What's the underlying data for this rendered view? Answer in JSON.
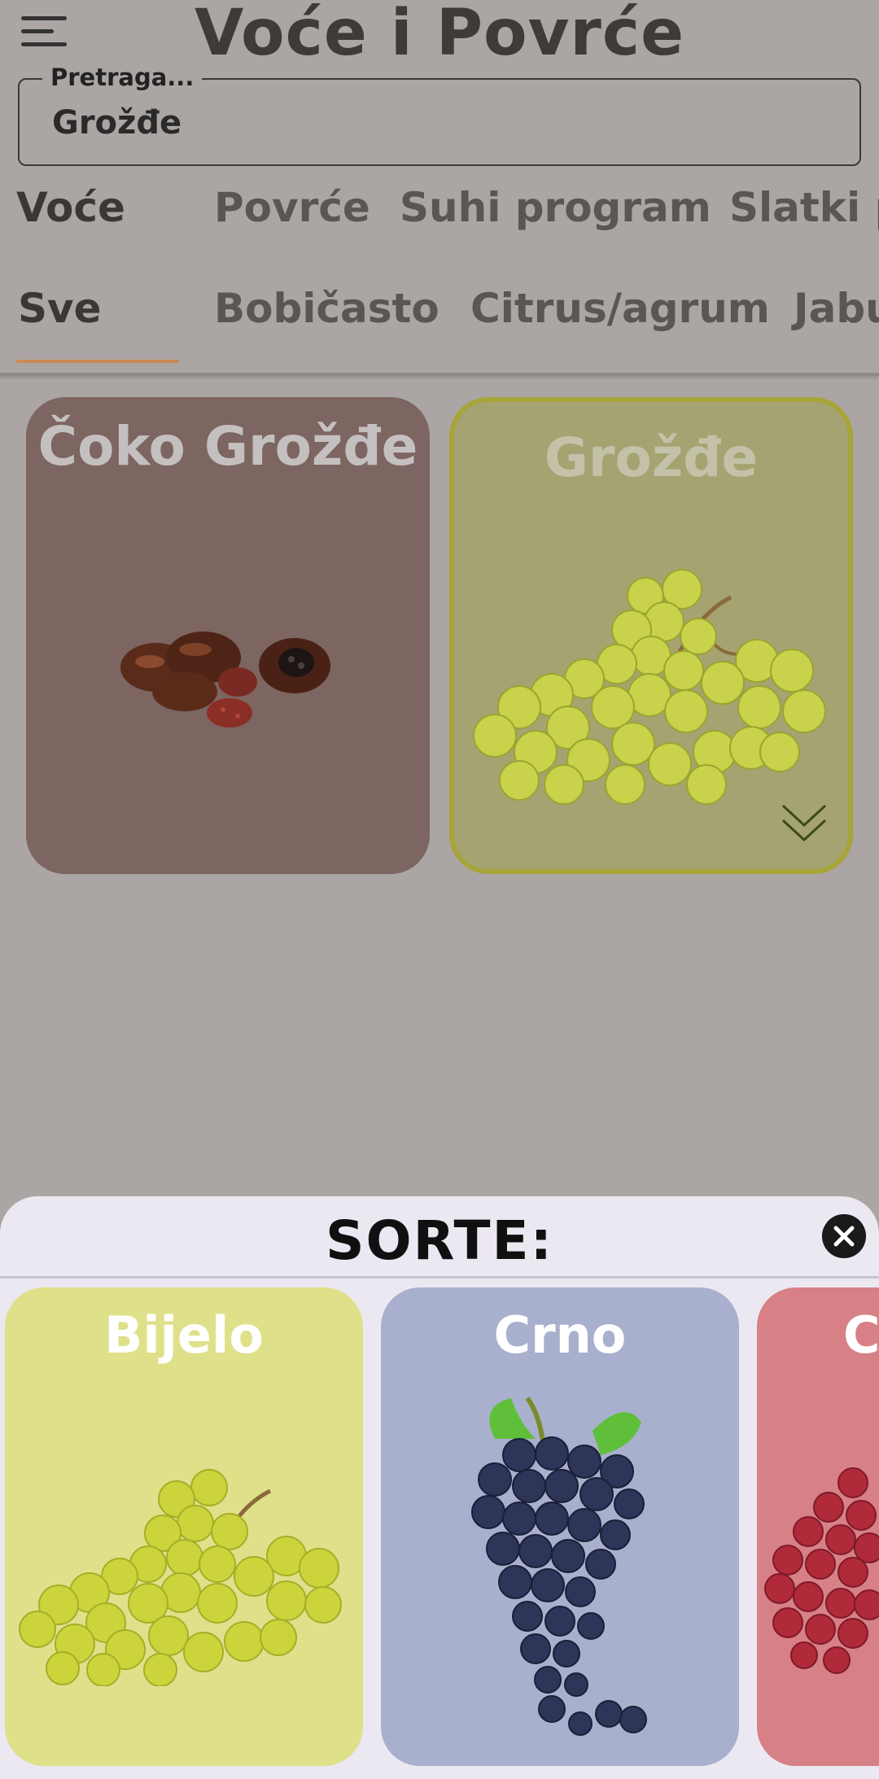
{
  "header": {
    "title": "Voće i Povrće",
    "menu_icon": "hamburger-menu-icon"
  },
  "search": {
    "label": "Pretraga...",
    "value": "Grožđe"
  },
  "category_tabs": [
    {
      "label": "Voće",
      "active": true
    },
    {
      "label": "Povrće",
      "active": false
    },
    {
      "label": "Suhi program",
      "active": false
    },
    {
      "label": "Slatki p",
      "active": false
    }
  ],
  "subcategory_tabs": [
    {
      "label": "Sve",
      "active": true
    },
    {
      "label": "Bobičasto",
      "active": false
    },
    {
      "label": "Citrus/agrum",
      "active": false
    },
    {
      "label": "Jabu",
      "active": false
    }
  ],
  "products": [
    {
      "title": "Čoko Grožđe",
      "color": "#7d6561",
      "selected": false
    },
    {
      "title": "Grožđe",
      "color": "#a5a371",
      "selected": true,
      "expand_icon": "chevron-double-down-icon"
    }
  ],
  "sheet": {
    "title": "SORTE:",
    "close_icon": "close-icon",
    "varieties": [
      {
        "title": "Bijelo",
        "color": "#dfe08a"
      },
      {
        "title": "Crno",
        "color": "#a9b0ce"
      },
      {
        "title": "C",
        "color": "#d78086"
      }
    ]
  },
  "colors": {
    "accent": "#c98a55",
    "background": "#aba6a4",
    "sheet": "#ece8f2"
  }
}
